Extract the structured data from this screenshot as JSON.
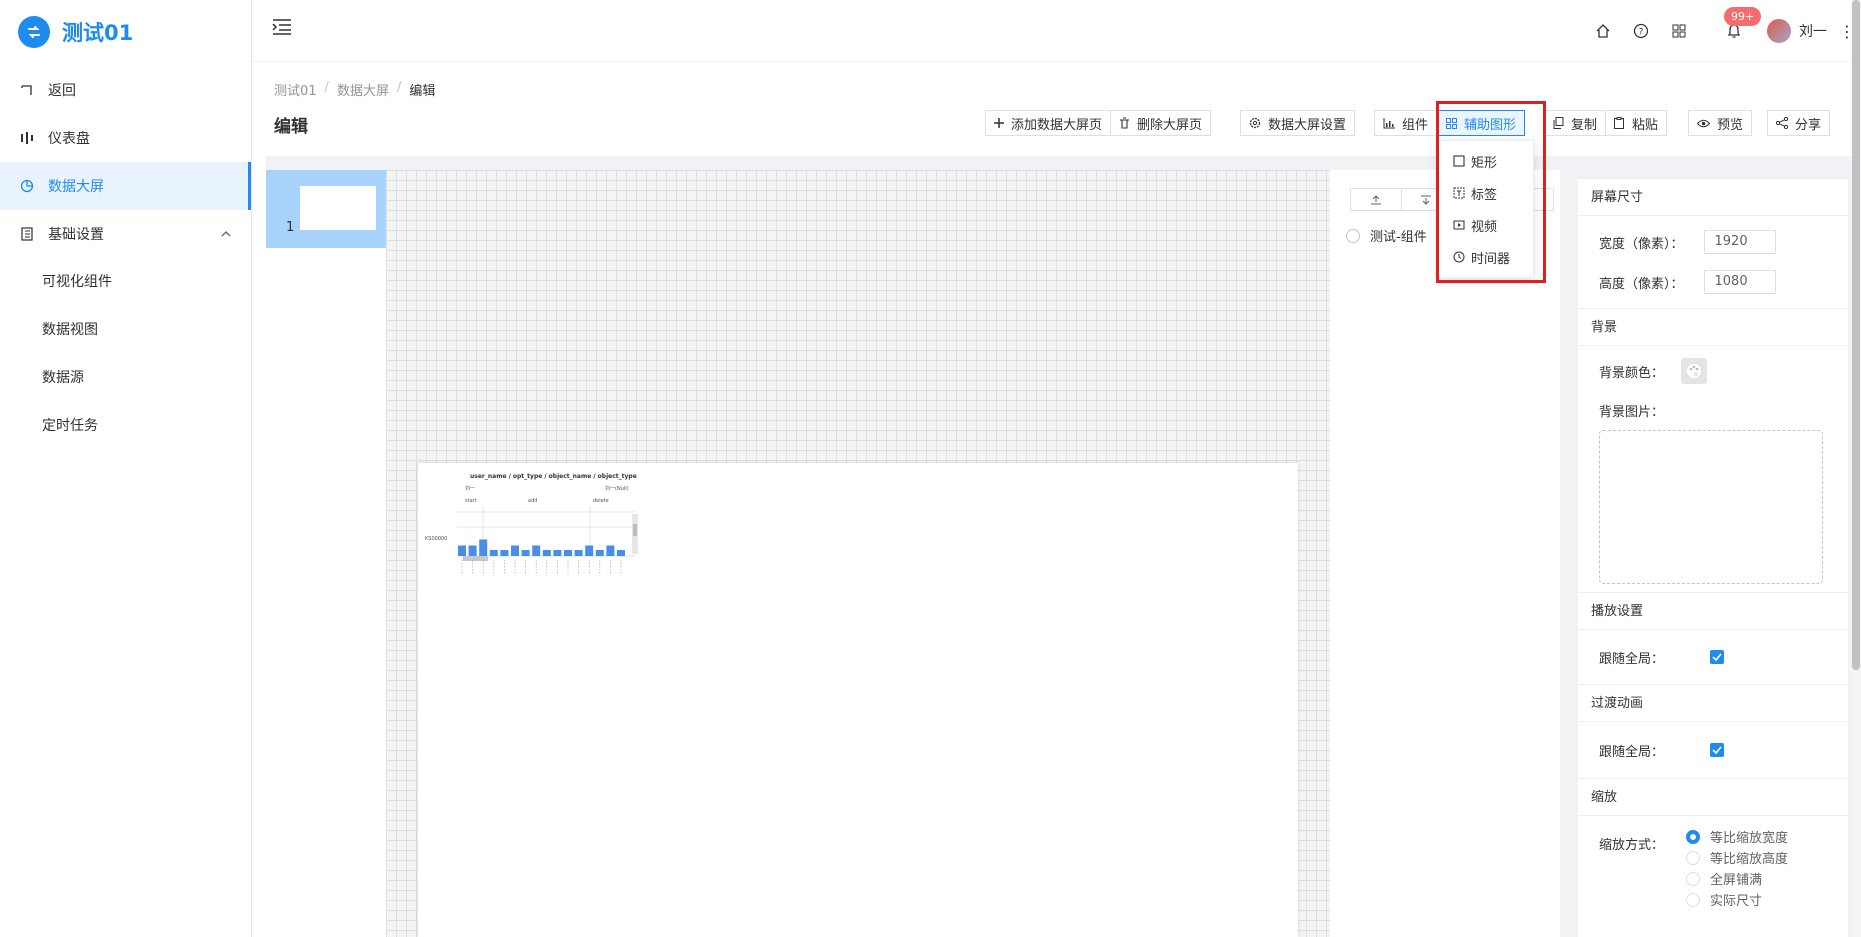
{
  "brand": {
    "title": "测试01",
    "accent": "#1e8bf0"
  },
  "sidebar": {
    "items": [
      {
        "label": "返回",
        "icon": "back-icon"
      },
      {
        "label": "仪表盘",
        "icon": "dashboard-icon"
      },
      {
        "label": "数据大屏",
        "icon": "pie-chart-icon",
        "active": true
      },
      {
        "label": "基础设置",
        "icon": "book-icon",
        "expanded": true
      }
    ],
    "sub_items": [
      "可视化组件",
      "数据视图",
      "数据源",
      "定时任务"
    ]
  },
  "header": {
    "icons": [
      "home-icon",
      "help-icon",
      "apps-icon",
      "bell-icon"
    ],
    "badge": "99+",
    "username": "刘一"
  },
  "breadcrumb": [
    "测试01",
    "数据大屏",
    "编辑"
  ],
  "page_title": "编辑",
  "toolbar": {
    "add_page": "添加数据大屏页",
    "delete_page": "删除大屏页",
    "screen_settings": "数据大屏设置",
    "components": "组件",
    "aux_shapes": "辅助图形",
    "copy": "复制",
    "paste": "粘贴",
    "preview": "预览",
    "share": "分享"
  },
  "dropdown": {
    "items": [
      {
        "label": "矩形",
        "icon": "rectangle-icon"
      },
      {
        "label": "标签",
        "icon": "label-icon"
      },
      {
        "label": "视频",
        "icon": "video-icon"
      },
      {
        "label": "时间器",
        "icon": "clock-icon"
      }
    ]
  },
  "thumbnails": {
    "page_number": "1"
  },
  "layers": {
    "item_label": "测试-组件"
  },
  "mini_chart": {
    "title": "user_name / opt_type / object_name / object_type",
    "groups": [
      "start",
      "add",
      "delete"
    ],
    "row_labels": [
      "刘一",
      "刘一(Null)"
    ],
    "axis_label": "KS00000",
    "values": [
      7,
      7,
      11,
      4,
      4,
      7,
      4,
      7,
      4,
      4,
      4,
      4,
      7,
      4,
      7,
      4
    ]
  },
  "properties": {
    "screen_size_title": "屏幕尺寸",
    "width_label": "宽度（像素）：",
    "width_value": "1920",
    "height_label": "高度（像素）：",
    "height_value": "1080",
    "background_title": "背景",
    "bg_color_label": "背景颜色：",
    "bg_image_label": "背景图片：",
    "playback_title": "播放设置",
    "follow_global_label": "跟随全局：",
    "transition_title": "过渡动画",
    "follow_global_label_2": "跟随全局：",
    "scale_title": "缩放",
    "scale_mode_label": "缩放方式：",
    "scale_options": [
      "等比缩放宽度",
      "等比缩放高度",
      "全屏铺满",
      "实际尺寸"
    ],
    "scale_selected": 0
  }
}
